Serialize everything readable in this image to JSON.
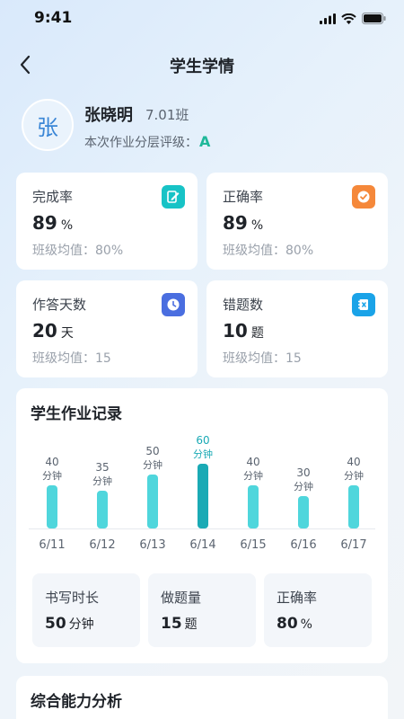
{
  "status_bar": {
    "time": "9:41"
  },
  "nav": {
    "title": "学生学情"
  },
  "student": {
    "avatar_char": "张",
    "name": "张晓明",
    "class": "7.01班",
    "grade_label": "本次作业分层评级：",
    "grade": "A"
  },
  "stats": [
    {
      "label": "完成率",
      "value": "89",
      "unit": "%",
      "avg": "班级均值：80%",
      "icon": "edit-icon",
      "color": "#17c3c6"
    },
    {
      "label": "正确率",
      "value": "89",
      "unit": "%",
      "avg": "班级均值：80%",
      "icon": "check-circle-icon",
      "color": "#f5883a"
    },
    {
      "label": "作答天数",
      "value": "20",
      "unit": "天",
      "avg": "班级均值：15",
      "icon": "clock-icon",
      "color": "#4a6ee0"
    },
    {
      "label": "错题数",
      "value": "10",
      "unit": "题",
      "avg": "班级均值：15",
      "icon": "notebook-icon",
      "color": "#1aa3e8"
    }
  ],
  "record": {
    "title": "学生作业记录",
    "summary": [
      {
        "label": "书写时长",
        "value": "50",
        "unit": "分钟"
      },
      {
        "label": "做题量",
        "value": "15",
        "unit": "题"
      },
      {
        "label": "正确率",
        "value": "80",
        "unit": "%"
      }
    ]
  },
  "chart_data": {
    "type": "bar",
    "categories": [
      "6/11",
      "6/12",
      "6/13",
      "6/14",
      "6/15",
      "6/16",
      "6/17"
    ],
    "values": [
      40,
      35,
      50,
      60,
      40,
      30,
      40
    ],
    "value_unit": "分钟",
    "highlight_index": 3,
    "colors": {
      "bar": "#4fd6dc",
      "highlight_bar": "#1aaab5",
      "highlight_label": "#1aaab5"
    },
    "ylim": [
      0,
      60
    ]
  },
  "analysis": {
    "title": "综合能力分析"
  }
}
